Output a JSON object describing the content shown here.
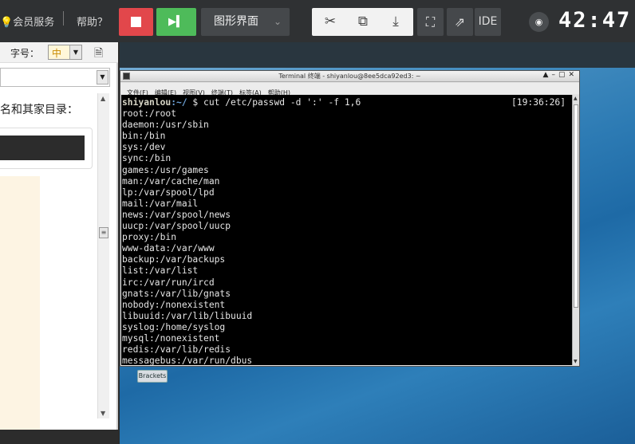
{
  "topbar": {
    "member_label": "会员服务",
    "help_label": "帮助？",
    "mode_label": "图形界面",
    "ide_label": "IDE",
    "timer": "42:47"
  },
  "left_panel": {
    "font_label": "字号：",
    "font_value": "中",
    "content_text": "名和其家目录："
  },
  "terminal": {
    "title": "Terminal 终端 - shiyanlou@8ee5dca92ed3: ~",
    "menu": [
      "文件(F)",
      "编辑(E)",
      "视图(V)",
      "终端(T)",
      "标签(A)",
      "帮助(H)"
    ],
    "prompt_user": "shiyanlou",
    "prompt_path": ":~/",
    "command": " $ cut /etc/passwd -d ':' -f 1,6",
    "clock": "[19:36:26]",
    "output": [
      "root:/root",
      "daemon:/usr/sbin",
      "bin:/bin",
      "sys:/dev",
      "sync:/bin",
      "games:/usr/games",
      "man:/var/cache/man",
      "lp:/var/spool/lpd",
      "mail:/var/mail",
      "news:/var/spool/news",
      "uucp:/var/spool/uucp",
      "proxy:/bin",
      "www-data:/var/www",
      "backup:/var/backups",
      "list:/var/list",
      "irc:/var/run/ircd",
      "gnats:/var/lib/gnats",
      "nobody:/nonexistent",
      "libuuid:/var/lib/libuuid",
      "syslog:/home/syslog",
      "mysql:/nonexistent",
      "redis:/var/lib/redis",
      "messagebus:/var/run/dbus"
    ]
  },
  "desktop": {
    "icon_label": "Brackets"
  }
}
